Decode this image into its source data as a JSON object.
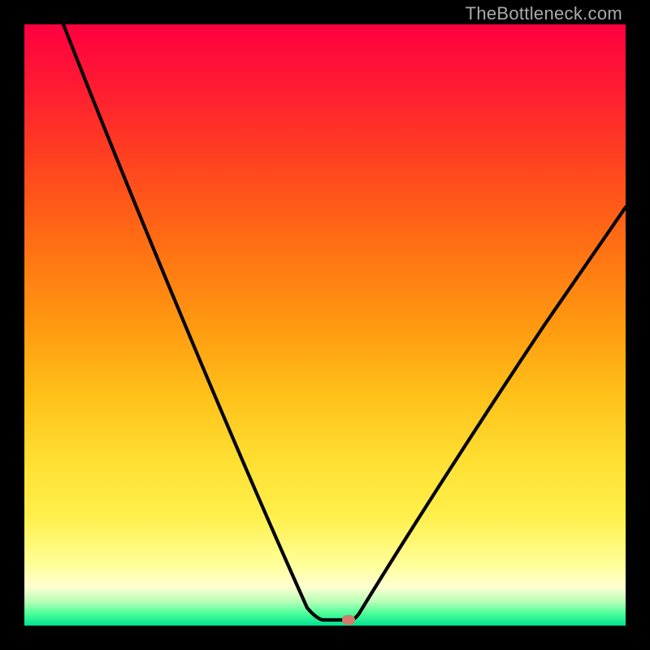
{
  "watermark": "TheBottleneck.com",
  "colors": {
    "gradient_top": "#ff0040",
    "gradient_mid": "#ffe033",
    "gradient_bottom": "#00e090",
    "curve": "#000000",
    "marker": "#d57a6b",
    "frame_bg": "#000000",
    "watermark_text": "#aaaaaa"
  },
  "chart_data": {
    "type": "line",
    "title": "",
    "xlabel": "",
    "ylabel": "",
    "xlim": [
      0,
      100
    ],
    "ylim": [
      0,
      100
    ],
    "grid": false,
    "legend": false,
    "series": [
      {
        "name": "bottleneck-curve",
        "x": [
          6,
          12,
          18,
          24,
          30,
          36,
          42,
          47,
          50,
          54,
          56,
          60,
          66,
          72,
          78,
          84,
          90,
          96,
          100
        ],
        "values": [
          100,
          84,
          70,
          58,
          46,
          35,
          24,
          13,
          4,
          1,
          1,
          6,
          14,
          24,
          34,
          43,
          52,
          60,
          67
        ]
      }
    ],
    "annotations": [
      {
        "name": "optimal-point",
        "x": 54,
        "y": 1
      }
    ],
    "background": "vertical-gradient-red-to-green",
    "notes": "y values estimated from curve height relative to 740px plot; minimum (optimal point) near x≈54%."
  }
}
